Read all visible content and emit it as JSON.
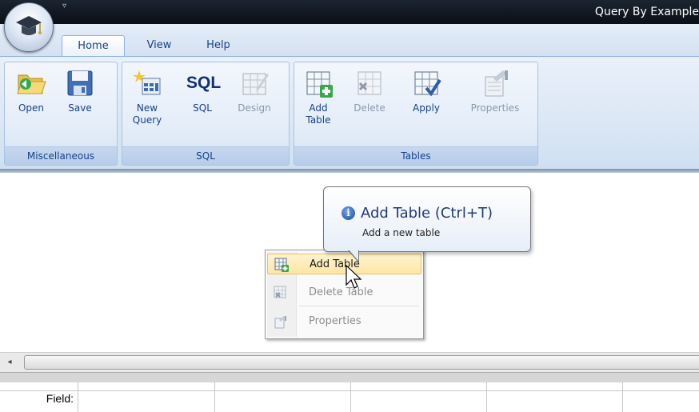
{
  "window": {
    "title": "Query By Example",
    "quick_access_glyph": "▿"
  },
  "tabs": [
    {
      "label": "Home",
      "active": true
    },
    {
      "label": "View",
      "active": false
    },
    {
      "label": "Help",
      "active": false
    }
  ],
  "groups": {
    "misc": {
      "label": "Miscellaneous",
      "buttons": {
        "open": "Open",
        "save": "Save"
      }
    },
    "sql": {
      "label": "SQL",
      "buttons": {
        "new_query": "New\nQuery",
        "sql": "SQL",
        "design": "Design"
      },
      "sql_icon_text": "SQL"
    },
    "tables": {
      "label": "Tables",
      "buttons": {
        "add_table": "Add\nTable",
        "delete": "Delete",
        "apply": "Apply",
        "properties": "Properties"
      }
    }
  },
  "tooltip": {
    "title": "Add Table (Ctrl+T)",
    "description": "Add a new table",
    "info_glyph": "i"
  },
  "context_menu": [
    {
      "label": "Add Table",
      "enabled": true,
      "highlighted": true,
      "icon": "add-table-icon"
    },
    {
      "label": "Delete Table",
      "enabled": false,
      "highlighted": false,
      "icon": "delete-table-icon"
    },
    {
      "label": "Properties",
      "enabled": false,
      "highlighted": false,
      "icon": "properties-icon"
    }
  ],
  "grid": {
    "row_label": "Field:"
  },
  "scrollbar": {
    "left_arrow": "◂"
  }
}
